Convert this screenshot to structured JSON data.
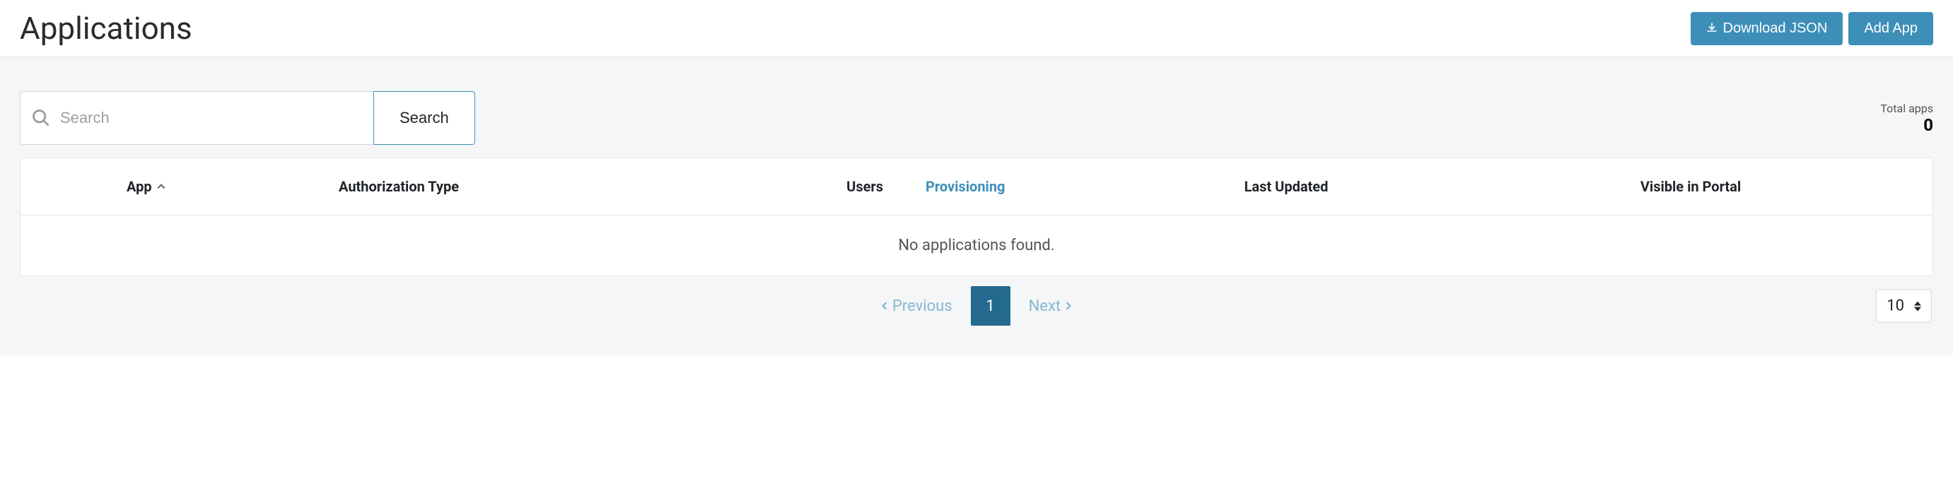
{
  "header": {
    "title": "Applications",
    "download_label": "Download JSON",
    "add_label": "Add App"
  },
  "search": {
    "placeholder": "Search",
    "button_label": "Search"
  },
  "totals": {
    "label": "Total apps",
    "count": "0"
  },
  "columns": {
    "app": "App",
    "auth_type": "Authorization Type",
    "users": "Users",
    "provisioning": "Provisioning",
    "last_updated": "Last Updated",
    "visible_in_portal": "Visible in Portal"
  },
  "empty_message": "No applications found.",
  "pagination": {
    "previous": "Previous",
    "next": "Next",
    "current_page": "1",
    "page_size": "10"
  }
}
